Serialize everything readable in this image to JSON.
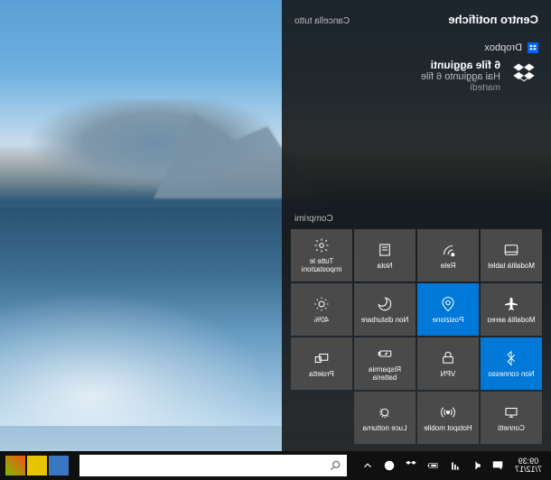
{
  "panel": {
    "title": "Centro notifiche",
    "clear_all": "Cancella tutto",
    "collapse": "Comprimi"
  },
  "notification": {
    "app_name": "Dropbox",
    "title": "6 file aggiunti",
    "subtitle": "Hai aggiunto 6 file",
    "day": "martedì"
  },
  "tiles": [
    [
      {
        "id": "tablet-mode",
        "label": "Modalità tablet",
        "active": false
      },
      {
        "id": "network",
        "label": "Rete",
        "active": false
      },
      {
        "id": "note",
        "label": "Nota",
        "active": false
      },
      {
        "id": "all-settings",
        "label": "Tutte le impostazioni",
        "active": false
      }
    ],
    [
      {
        "id": "airplane-mode",
        "label": "Modalità aereo",
        "active": false
      },
      {
        "id": "location",
        "label": "Posizione",
        "active": true
      },
      {
        "id": "quiet-hours",
        "label": "Non disturbare",
        "active": false
      },
      {
        "id": "brightness",
        "label": "40%",
        "active": false
      }
    ],
    [
      {
        "id": "bluetooth",
        "label": "Non connesso",
        "active": true
      },
      {
        "id": "vpn",
        "label": "VPN",
        "active": false
      },
      {
        "id": "battery-saver",
        "label": "Risparmia batteria",
        "active": false
      },
      {
        "id": "project",
        "label": "Proietta",
        "active": false
      }
    ],
    [
      {
        "id": "connect",
        "label": "Connetti",
        "active": false
      },
      {
        "id": "hotspot",
        "label": "Hotspot mobile",
        "active": false
      },
      {
        "id": "night-light",
        "label": "Luce notturna",
        "active": false
      }
    ]
  ],
  "taskbar": {
    "time": "09:39",
    "date": "7/12/17"
  }
}
